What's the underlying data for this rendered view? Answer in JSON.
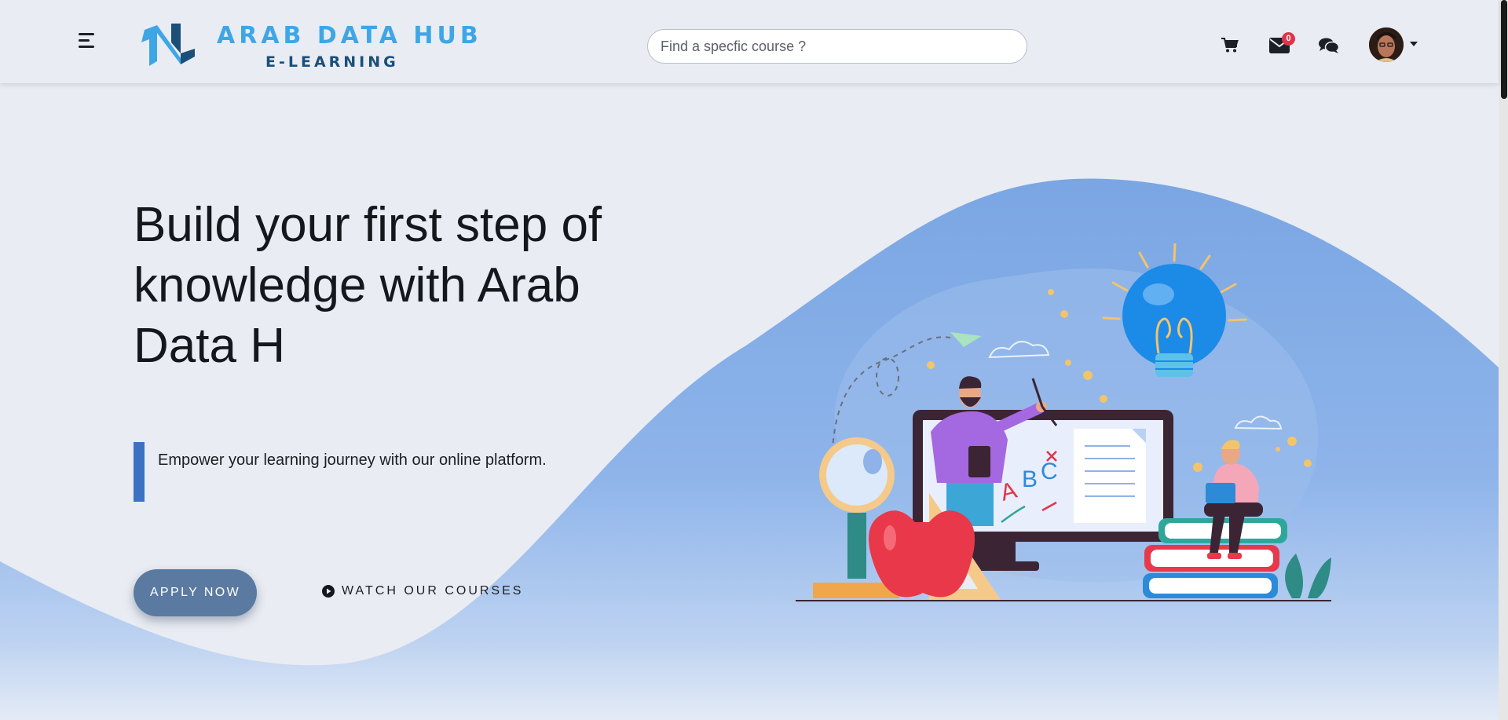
{
  "header": {
    "logo": {
      "line1": "ARAB DATA HUB",
      "line2": "E-LEARNING"
    },
    "search": {
      "placeholder": "Find a specfic course ?",
      "value": ""
    },
    "icons": [
      "menu-icon",
      "cart-icon",
      "mail-icon",
      "chat-icon"
    ],
    "mail_badge": "0"
  },
  "hero": {
    "title": "Build your first step of knowledge with Arab Data H",
    "subtitle": "Empower your learning journey with our online platform.",
    "apply_button": "APPLY NOW",
    "watch_link": "WATCH OUR COURSES"
  },
  "colors": {
    "accent_blue": "#3d72c2",
    "button": "#5b7aa1",
    "wave_blue": "#7aa7e4",
    "badge_red": "#e0344b",
    "logo_light": "#3fa6e6",
    "logo_dark": "#1a4f7a"
  }
}
